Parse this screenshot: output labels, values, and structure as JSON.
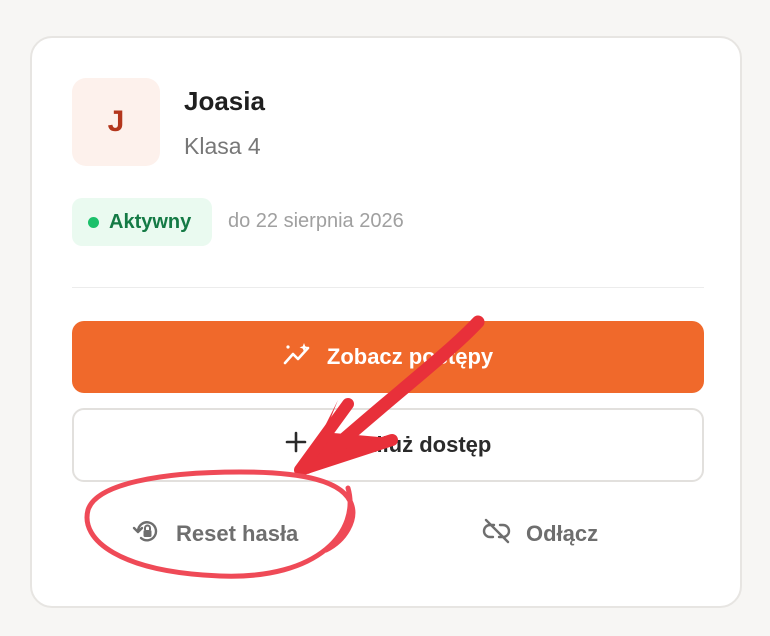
{
  "student": {
    "initial": "J",
    "name": "Joasia",
    "class": "Klasa 4"
  },
  "status": {
    "label": "Aktywny",
    "until": "do 22 sierpnia 2026"
  },
  "actions": {
    "progress_label": "Zobacz postępy",
    "extend_label": "Przedłuż dostęp",
    "reset_label": "Reset hasła",
    "detach_label": "Odłącz"
  },
  "icons": {
    "progress": "sparkle-chart-icon",
    "extend": "plus-icon",
    "reset": "lock-reset-icon",
    "detach": "unlink-icon"
  },
  "colors": {
    "accent": "#f0692b",
    "status_green": "#1bc06a",
    "annotation_red": "#e8303a"
  }
}
